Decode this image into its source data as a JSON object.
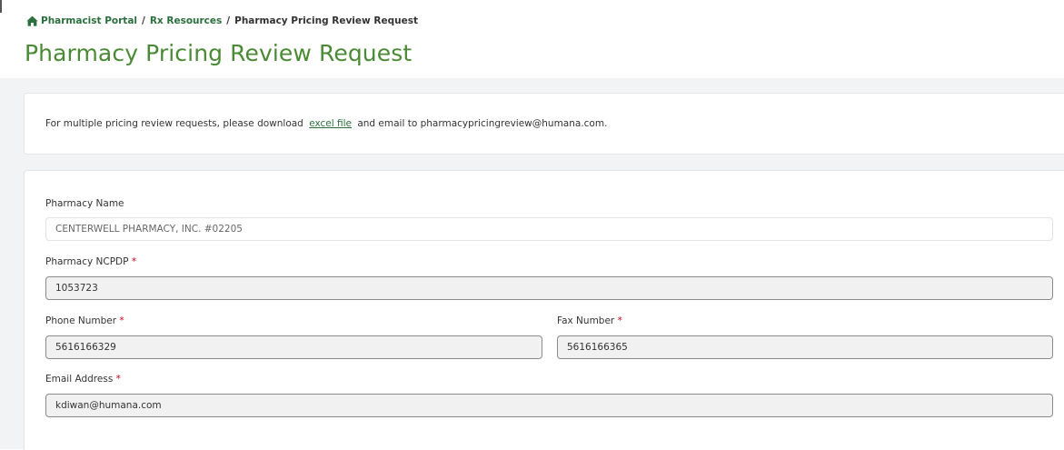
{
  "breadcrumb": {
    "items": [
      "Pharmacist Portal",
      "Rx Resources",
      "Pharmacy Pricing Review Request"
    ],
    "separator": "/"
  },
  "page_title": "Pharmacy Pricing Review Request",
  "info": {
    "text_before": "For multiple pricing review requests, please download",
    "link_label": "excel file",
    "text_after": "and email to pharmacypricingreview@humana.com."
  },
  "form": {
    "pharmacy_name": {
      "label": "Pharmacy Name",
      "value": "CENTERWELL PHARMACY, INC. #02205"
    },
    "ncpdp": {
      "label": "Pharmacy NCPDP",
      "required_mark": "*",
      "value": "1053723"
    },
    "phone": {
      "label": "Phone Number",
      "required_mark": "*",
      "value": "5616166329"
    },
    "fax": {
      "label": "Fax Number",
      "required_mark": "*",
      "value": "5616166365"
    },
    "email": {
      "label": "Email Address",
      "required_mark": "*",
      "value": "kdiwan@humana.com"
    }
  },
  "colors": {
    "brand_green": "#2a6f3c",
    "title_green": "#4a8a35",
    "required_red": "#d0021b",
    "band_gray": "#f2f3f4"
  },
  "icons": {
    "breadcrumb_home": "home-icon"
  }
}
